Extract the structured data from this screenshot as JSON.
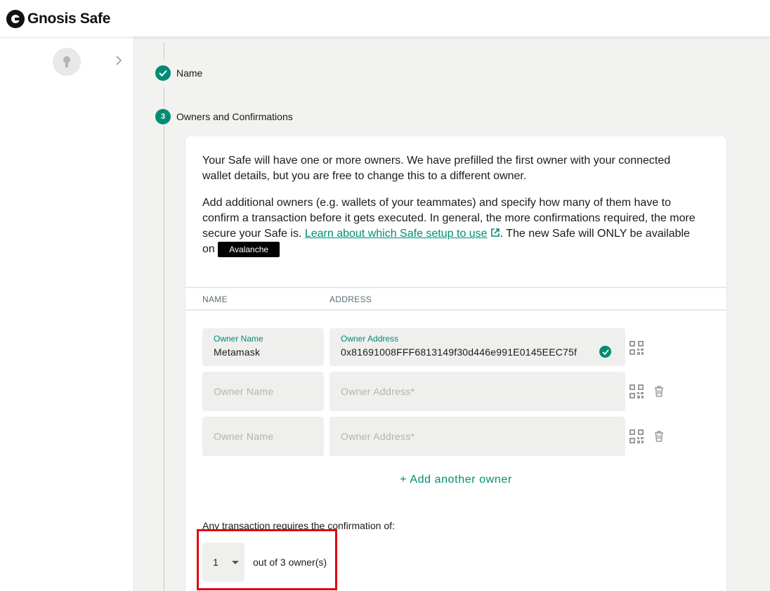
{
  "app": {
    "name": "Gnosis Safe"
  },
  "sidebar": {
    "avatar_icon": "keyhole-icon",
    "expand_icon": "chevron-right-icon"
  },
  "steps": [
    {
      "status": "done",
      "label": "Name"
    },
    {
      "status": "active",
      "number": "3",
      "label": "Owners and Confirmations"
    }
  ],
  "description": {
    "paragraph1": "Your Safe will have one or more owners. We have prefilled the first owner with your connected wallet details, but you are free to change this to a different owner.",
    "paragraph2_before_link": "Add additional owners (e.g. wallets of your teammates) and specify how many of them have to confirm a transaction before it gets executed. In general, the more confirmations required, the more secure your Safe is. ",
    "link_text": "Learn about which Safe setup to use",
    "paragraph2_after_link": ". The new Safe will ONLY be available on ",
    "network": "Avalanche"
  },
  "table": {
    "col_name": "NAME",
    "col_address": "ADDRESS"
  },
  "owners": [
    {
      "name_label": "Owner Name",
      "name_value": "Metamask",
      "address_label": "Owner Address",
      "address_value": "0x81691008FFF6813149f30d446e991E0145EEC75f",
      "valid": true
    },
    {
      "name_placeholder": "Owner Name",
      "address_placeholder": "Owner Address*"
    },
    {
      "name_placeholder": "Owner Name",
      "address_placeholder": "Owner Address*"
    }
  ],
  "add_owner_label": "+ Add another owner",
  "confirmations": {
    "label": "Any transaction requires the confirmation of:",
    "selected": "1",
    "suffix": "out of 3 owner(s)"
  },
  "colors": {
    "accent": "#008c73",
    "highlight": "#e3000f"
  }
}
